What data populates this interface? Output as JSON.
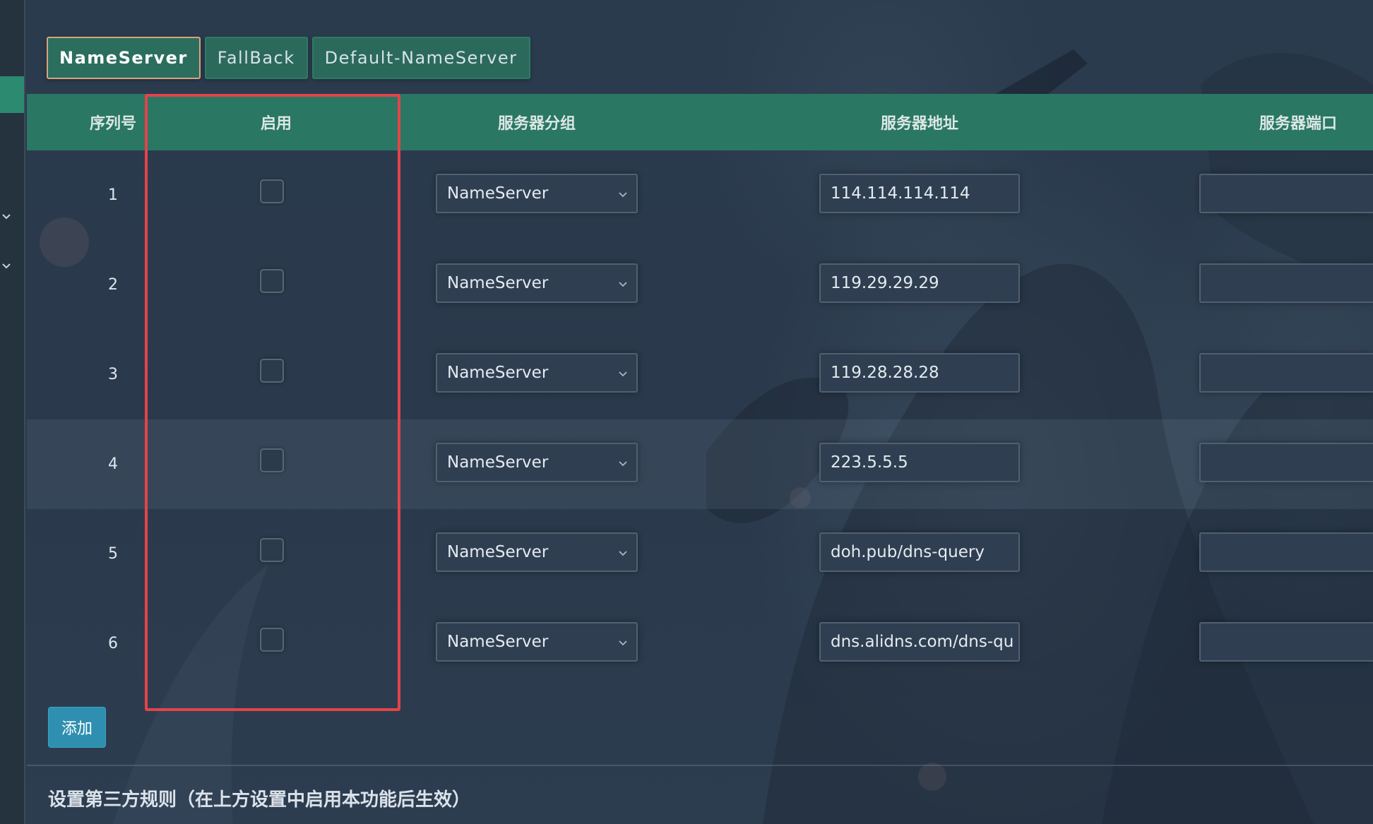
{
  "tabs": [
    {
      "label": "NameServer",
      "active": true
    },
    {
      "label": "FallBack",
      "active": false
    },
    {
      "label": "Default-NameServer",
      "active": false
    }
  ],
  "table": {
    "headers": {
      "index": "序列号",
      "enabled": "启用",
      "group": "服务器分组",
      "address": "服务器地址",
      "port": "服务器端口"
    },
    "rows": [
      {
        "index": "1",
        "enabled": false,
        "group": "NameServer",
        "address": "114.114.114.114",
        "port": ""
      },
      {
        "index": "2",
        "enabled": false,
        "group": "NameServer",
        "address": "119.29.29.29",
        "port": ""
      },
      {
        "index": "3",
        "enabled": false,
        "group": "NameServer",
        "address": "119.28.28.28",
        "port": ""
      },
      {
        "index": "4",
        "enabled": false,
        "group": "NameServer",
        "address": "223.5.5.5",
        "port": ""
      },
      {
        "index": "5",
        "enabled": false,
        "group": "NameServer",
        "address": "doh.pub/dns-query",
        "port": ""
      },
      {
        "index": "6",
        "enabled": false,
        "group": "NameServer",
        "address": "dns.alidns.com/dns-qu",
        "port": ""
      }
    ]
  },
  "actions": {
    "add_label": "添加"
  },
  "section": {
    "title": "设置第三方规则（在上方设置中启用本功能后生效）"
  },
  "colors": {
    "accent": "#2a7763",
    "highlight_box": "#e4434a",
    "add_button": "#2e8fb0",
    "active_tab_border": "#d9a47c"
  }
}
